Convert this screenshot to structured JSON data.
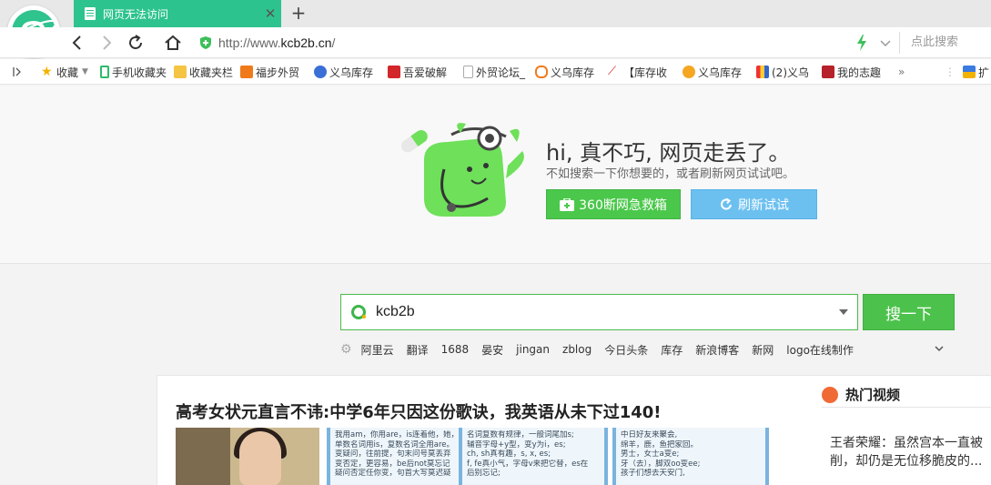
{
  "tab": {
    "title": "网页无法访问"
  },
  "address": {
    "url_prefix": "http://www.",
    "url_domain": "kcb2b.cn",
    "url_suffix": "/",
    "search_placeholder": "点此搜索"
  },
  "bookmarks": [
    {
      "label": "收藏"
    },
    {
      "label": "手机收藏夹"
    },
    {
      "label": "收藏夹栏"
    },
    {
      "label": "福步外贸"
    },
    {
      "label": "义乌库存"
    },
    {
      "label": "吾爱破解"
    },
    {
      "label": "外贸论坛_"
    },
    {
      "label": "义乌库存"
    },
    {
      "label": "【库存收"
    },
    {
      "label": "义乌库存"
    },
    {
      "label": "(2)义乌"
    },
    {
      "label": "我的志趣"
    },
    {
      "label": "»"
    },
    {
      "label": "扩"
    }
  ],
  "error": {
    "title": "hi, 真不巧, 网页走丢了。",
    "subtitle": "不如搜索一下你想要的，或者刷新网页试试吧。",
    "rescue_label": "360断网急救箱",
    "refresh_label": "刷新试试"
  },
  "search": {
    "value": "kcb2b",
    "button_label": "搜一下",
    "hotwords": [
      "阿里云",
      "翻译",
      "1688",
      "晏安",
      "jingan",
      "zblog",
      "今日头条",
      "库存",
      "新浪博客",
      "新网",
      "logo在线制作"
    ]
  },
  "news": {
    "headline": "高考女状元直言不讳:中学6年只因这份歌诀，我英语从未下过140!",
    "thumb2_lines": [
      "我用am，你用are，is连着他，她，它;",
      "单数名词用is，复数名词全用are。",
      "变疑问，往前提，句末问号莫丢弃",
      "变否定，更容易，be后not莫忘记",
      "疑问否定任你变，句首大写莫迟疑"
    ],
    "thumb3_lines": [
      "名词复数有规律，一般词尾加s;",
      "辅音字母+y型，变y为i，es;",
      "ch, sh真有趣，s, x, es;",
      "f, fe真小气，字母v来把它替，es在",
      "后别忘记;"
    ],
    "thumb4_lines": [
      "中日好友来聚会,",
      "绵羊，鹿，鱼把家回。",
      "男士，女士a变e;",
      "牙（去），脚双oo变ee;",
      "孩子们想去天安门,"
    ]
  },
  "hot_video": {
    "header": "热门视频",
    "text_line1": "王者荣耀：虽然宫本一直被",
    "text_line2": "削，却仍是无位移脆皮的..."
  },
  "colors": {
    "tab_green": "#2dc38f",
    "button_green": "#4bc84b",
    "button_blue": "#6cc0f0",
    "mascot_green": "#6ee05a"
  }
}
